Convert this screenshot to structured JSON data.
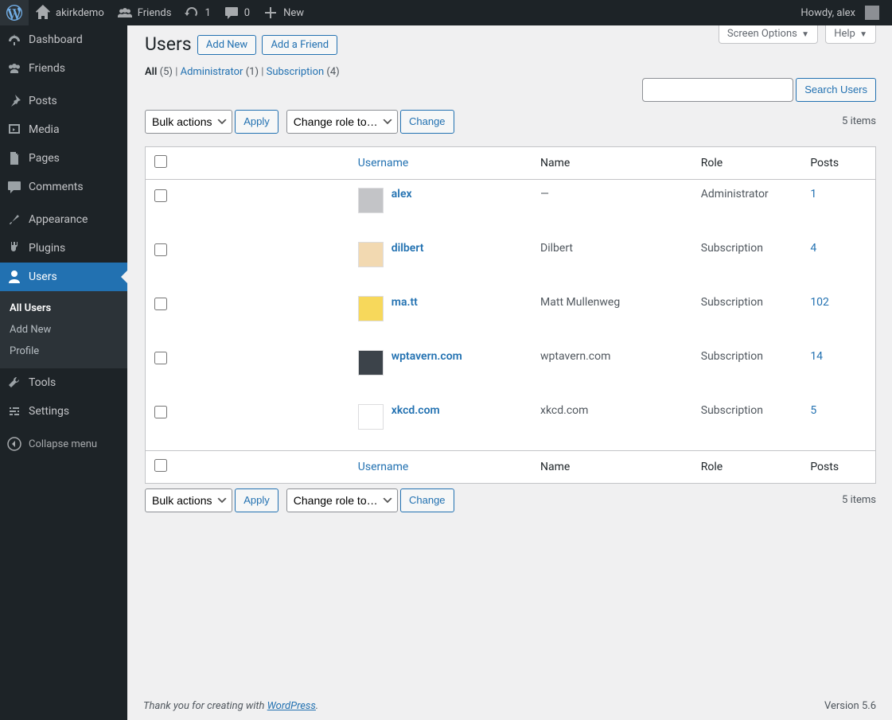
{
  "adminbar": {
    "site_name": "akirkdemo",
    "friends_label": "Friends",
    "refresh_count": "1",
    "comments_count": "0",
    "new_label": "New",
    "howdy": "Howdy, alex"
  },
  "menu": {
    "dashboard": "Dashboard",
    "friends": "Friends",
    "posts": "Posts",
    "media": "Media",
    "pages": "Pages",
    "comments": "Comments",
    "appearance": "Appearance",
    "plugins": "Plugins",
    "users": "Users",
    "tools": "Tools",
    "settings": "Settings",
    "collapse": "Collapse menu"
  },
  "submenu": {
    "all_users": "All Users",
    "add_new": "Add New",
    "profile": "Profile"
  },
  "screen_meta": {
    "screen_options": "Screen Options",
    "help": "Help"
  },
  "heading": {
    "title": "Users",
    "add_new": "Add New",
    "add_friend": "Add a Friend"
  },
  "views": {
    "all_label": "All",
    "all_count": "(5)",
    "admin_label": "Administrator",
    "admin_count": "(1)",
    "sub_label": "Subscription",
    "sub_count": "(4)",
    "sep": "  |  "
  },
  "search": {
    "button": "Search Users"
  },
  "bulk": {
    "bulk_label": "Bulk actions",
    "apply": "Apply",
    "role_label": "Change role to…",
    "change": "Change"
  },
  "pagination": {
    "text": "5 items"
  },
  "columns": {
    "username": "Username",
    "name": "Name",
    "role": "Role",
    "posts": "Posts"
  },
  "rows": [
    {
      "username": "alex",
      "name": "—",
      "role": "Administrator",
      "posts": "1",
      "avatar": "#c3c4c7"
    },
    {
      "username": "dilbert",
      "name": "Dilbert",
      "role": "Subscription",
      "posts": "4",
      "avatar": "#f2d9b1"
    },
    {
      "username": "ma.tt",
      "name": "Matt Mullenweg",
      "role": "Subscription",
      "posts": "102",
      "avatar": "#f7d85b"
    },
    {
      "username": "wptavern.com",
      "name": "wptavern.com",
      "role": "Subscription",
      "posts": "14",
      "avatar": "#3c434a"
    },
    {
      "username": "xkcd.com",
      "name": "xkcd.com",
      "role": "Subscription",
      "posts": "5",
      "avatar": "#ffffff"
    }
  ],
  "footer": {
    "thanks_prefix": "Thank you for creating with ",
    "thanks_link": "WordPress",
    "thanks_suffix": ".",
    "version": "Version 5.6"
  }
}
